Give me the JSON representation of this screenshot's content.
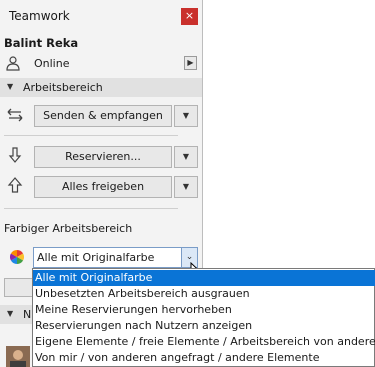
{
  "panel": {
    "title": "Teamwork",
    "close_symbol": "×",
    "user_name": "Balint Reka",
    "status": "Online",
    "status_arrow": "▶",
    "section_workspace": "Arbeitsbereich",
    "section_collapse_symbol": "▼",
    "send_receive_label": "Senden & empfangen",
    "reserve_label": "Reservieren...",
    "release_all_label": "Alles freigeben",
    "dropdown_arrow": "▼",
    "colored_workspace_label": "Farbiger Arbeitsbereich",
    "next_section_partial": "N",
    "icons": {
      "status": "person-icon",
      "send_receive": "swap-arrows-icon",
      "reserve": "down-arrow-icon",
      "release": "up-arrow-icon",
      "color": "color-wheel-icon",
      "avatar": "user-avatar-icon"
    }
  },
  "color_select": {
    "value": "Alle mit Originalfarbe",
    "arrow": "⌄",
    "options": [
      "Alle mit Originalfarbe",
      "Unbesetzten Arbeitsbereich ausgrauen",
      "Meine Reservierungen hervorheben",
      "Reservierungen nach Nutzern anzeigen",
      "Eigene Elemente / freie Elemente / Arbeitsbereich von anderen",
      "Von mir / von anderen angefragt / andere Elemente"
    ]
  },
  "colors": {
    "selection": "#0a74d6",
    "close_button": "#c9302c",
    "panel_bg": "#f3f3f3"
  }
}
